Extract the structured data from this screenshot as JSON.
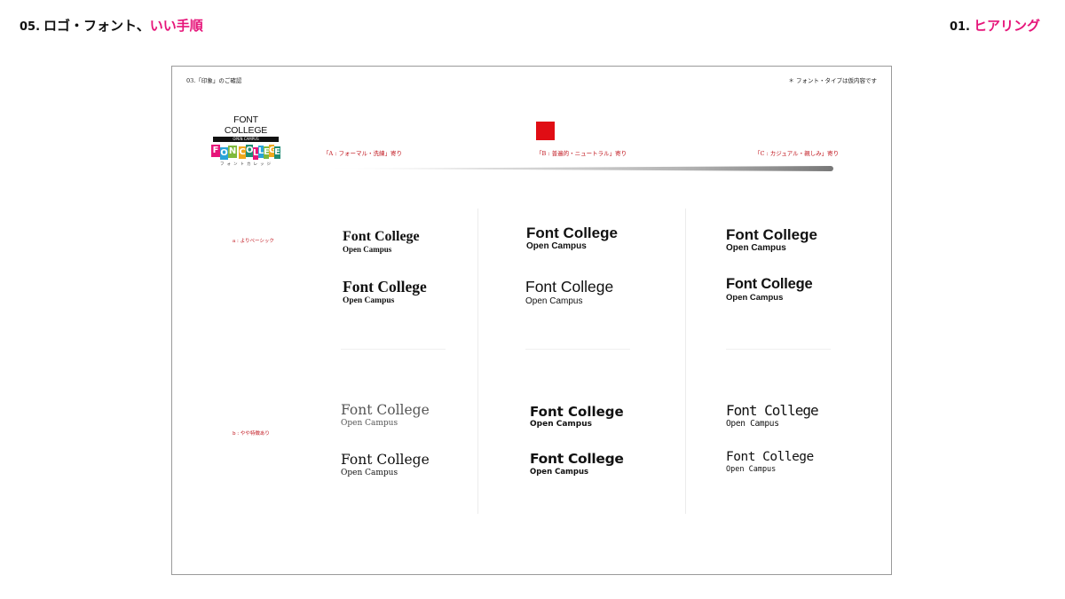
{
  "header": {
    "left": {
      "number": "05.",
      "plain": "ロゴ・フォント、",
      "accent": "いい手順"
    },
    "right": {
      "number": "01.",
      "accent": "ヒアリング"
    }
  },
  "sheet": {
    "title": "03.「印象」のご確認",
    "note": "＊ フォント・タイプは仮内容です",
    "logo_plain": {
      "name": "FONT COLLEGE",
      "bar": "OPEN CAMPUS"
    },
    "logo_color": {
      "letters": [
        "F",
        "O",
        "N",
        "C",
        "O",
        "L",
        "L",
        "E",
        "G",
        "E"
      ],
      "sub": "フォントカレッジ"
    },
    "categories": {
      "a": "「A : フォーマル・洗練」寄り",
      "b": "「B : 普遍的・ニュートラル」寄り",
      "c": "「C : カジュアル・親しみ」寄り"
    },
    "rows": {
      "a": "a : よりベーシック",
      "b": "b : やや特徴あり"
    },
    "sample_title": "Font College",
    "sample_sub": "Open Campus"
  },
  "colors": {
    "accent": "#e6157a",
    "red": "#e00d14",
    "category": "#c0141c"
  }
}
